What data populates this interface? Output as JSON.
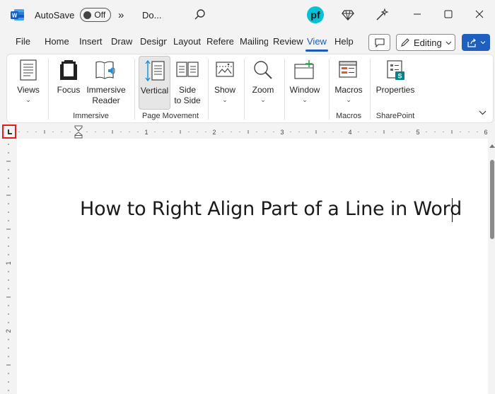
{
  "titlebar": {
    "autosave_label": "AutoSave",
    "autosave_state": "Off",
    "overflow": "»",
    "doc_name": "Do...",
    "search_icon": "search-icon",
    "logo_text": "pf",
    "diamond_icon": "diamond-icon",
    "designer_icon": "magic-wand-icon"
  },
  "tabs": [
    {
      "label": "File"
    },
    {
      "label": "Home"
    },
    {
      "label": "Insert"
    },
    {
      "label": "Draw"
    },
    {
      "label": "Design"
    },
    {
      "label": "Layout"
    },
    {
      "label": "References"
    },
    {
      "label": "Mailings"
    },
    {
      "label": "Review"
    },
    {
      "label": "View"
    },
    {
      "label": "Help"
    }
  ],
  "active_tab": "View",
  "editing": {
    "label": "Editing",
    "chevron": "⌄"
  },
  "ribbon": {
    "views": {
      "label": "Views"
    },
    "focus": {
      "label": "Focus"
    },
    "immersive_reader": {
      "label1": "Immersive",
      "label2": "Reader"
    },
    "vertical": {
      "label": "Vertical"
    },
    "side_to_side": {
      "label1": "Side",
      "label2": "to Side"
    },
    "show": {
      "label": "Show"
    },
    "zoom": {
      "label": "Zoom"
    },
    "window": {
      "label": "Window"
    },
    "macros": {
      "label": "Macros"
    },
    "properties": {
      "label": "Properties"
    },
    "groups": {
      "immersive": "Immersive",
      "page_movement": "Page Movement",
      "macros": "Macros",
      "sharepoint": "SharePoint"
    }
  },
  "ruler": {
    "marks": [
      "1",
      "2",
      "3",
      "4",
      "5",
      "6"
    ],
    "vmarks": [
      "1",
      "2"
    ]
  },
  "document": {
    "text": "How to Right Align Part of a Line in Word"
  },
  "colors": {
    "accent": "#185abd",
    "share": "#1f5fbf",
    "highlight": "#e01e1e"
  }
}
